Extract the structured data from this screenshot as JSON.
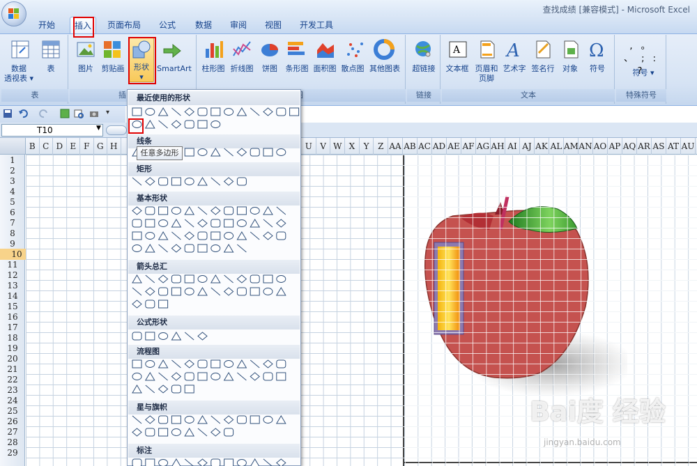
{
  "window": {
    "title": "查找成绩  [兼容模式] - Microsoft Excel"
  },
  "tabs": [
    "开始",
    "插入",
    "页面布局",
    "公式",
    "数据",
    "审阅",
    "视图",
    "开发工具"
  ],
  "ribbon": {
    "table_group": {
      "label": "表",
      "pivot": "数据\n透视表 ▾",
      "table": "表"
    },
    "illustrations": {
      "picture": "图片",
      "clipart": "剪贴画",
      "shapes": "形状",
      "shapes_arrow": "▾",
      "smartart": "SmartArt",
      "label": "插"
    },
    "charts": {
      "column": "柱形图",
      "line": "折线图",
      "pie": "饼图",
      "bar": "条形图",
      "area": "面积图",
      "scatter": "散点图",
      "other": "其他图表",
      "label": "图"
    },
    "links": {
      "hyperlink": "超链接",
      "label": "链接"
    },
    "text": {
      "textbox": "文本框",
      "header": "页眉和\n页脚",
      "wordart": "艺术字",
      "signature": "签名行",
      "object": "对象",
      "symbol": "符号",
      "label": "文本"
    },
    "special": {
      "symbols": "符号 ▾",
      "label": "特殊符号",
      "marks": ", 。 、 ; : ?"
    }
  },
  "formula_bar": {
    "cell_ref": "T10"
  },
  "columns": [
    "B",
    "C",
    "D",
    "E",
    "F",
    "G",
    "H",
    "",
    "",
    "",
    "",
    "",
    "",
    "",
    "U",
    "V",
    "W",
    "X",
    "Y",
    "Z",
    "AA",
    "AB",
    "AC",
    "AD",
    "AE",
    "AF",
    "AG",
    "AH",
    "AI",
    "AJ",
    "AK",
    "AL",
    "AM",
    "AN",
    "AO",
    "AP",
    "AQ",
    "AR",
    "AS",
    "AT",
    "AU"
  ],
  "rows": [
    "1",
    "2",
    "3",
    "4",
    "5",
    "6",
    "7",
    "8",
    "9",
    "10",
    "11",
    "12",
    "13",
    "14",
    "15",
    "16",
    "17",
    "18",
    "19",
    "20",
    "21",
    "22",
    "23",
    "24",
    "25",
    "26",
    "27",
    "28",
    "29"
  ],
  "gallery": {
    "recent": "最近使用的形状",
    "lines": "线条",
    "rect": "矩形",
    "basic": "基本形状",
    "arrows": "箭头总汇",
    "formula": "公式形状",
    "flowchart": "流程图",
    "stars": "星与旗帜",
    "callouts": "标注"
  },
  "tooltip": "任意多边形",
  "watermark": {
    "main": "Bai度 经验",
    "sub": "jingyan.baidu.com"
  },
  "colors": {
    "accent": "#e00000",
    "apple": "#c5524f"
  }
}
